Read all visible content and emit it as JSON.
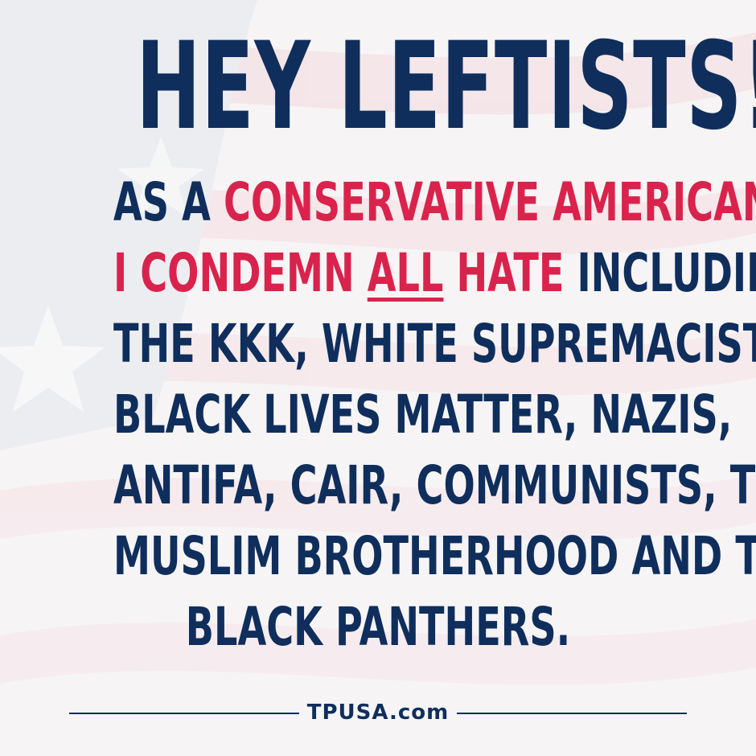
{
  "headline": "HEY LEFTISTS!",
  "lines": [
    [
      {
        "text": "AS A ",
        "color": "navy"
      },
      {
        "text": "CONSERVATIVE AMERICAN",
        "color": "red"
      }
    ],
    [
      {
        "text": "I CONDEMN ",
        "color": "red"
      },
      {
        "text": "ALL",
        "color": "red",
        "underline": true
      },
      {
        "text": " HATE",
        "color": "red"
      },
      {
        "text": " INCLUDING",
        "color": "navy"
      }
    ],
    [
      {
        "text": "THE KKK, WHITE SUPREMACISTS,",
        "color": "navy"
      }
    ],
    [
      {
        "text": "BLACK LIVES MATTER, NAZIS,",
        "color": "navy"
      }
    ],
    [
      {
        "text": "ANTIFA, CAIR, COMMUNISTS, THE",
        "color": "navy"
      }
    ],
    [
      {
        "text": "MUSLIM BROTHERHOOD AND THE",
        "color": "navy"
      }
    ],
    [
      {
        "text": "BLACK PANTHERS.",
        "color": "navy"
      }
    ]
  ],
  "footer": {
    "text": "TPUSA.com"
  },
  "colors": {
    "navy": "#0f2e5c",
    "red": "#d9234c",
    "background": "#f6f4f5"
  }
}
